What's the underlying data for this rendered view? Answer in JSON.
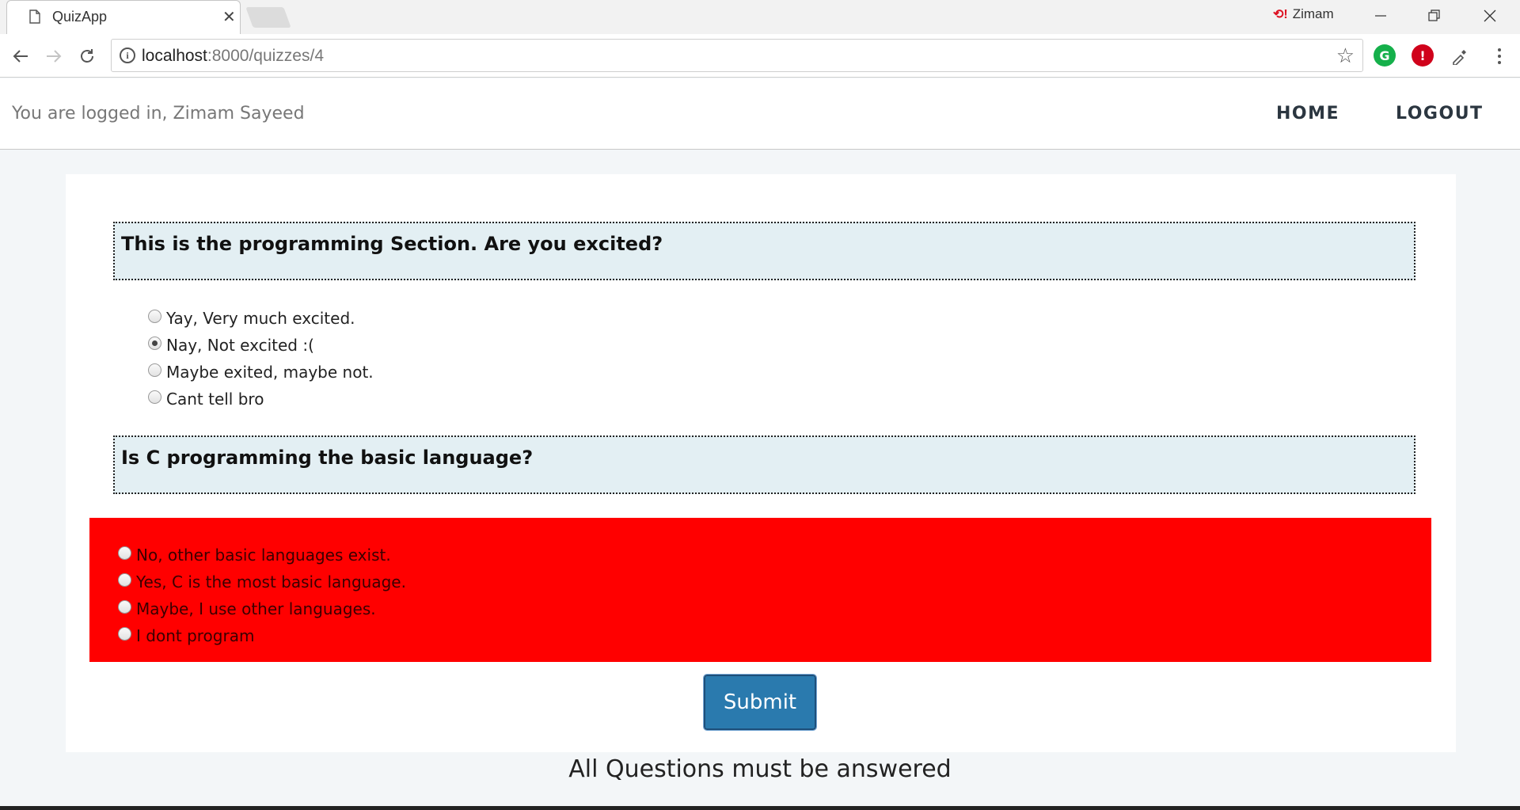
{
  "browser": {
    "tab_title": "QuizApp",
    "profile_name": "Zimam",
    "url_host": "localhost",
    "url_path": ":8000/quizzes/4"
  },
  "nav": {
    "login_text": "You are logged in, Zimam Sayeed",
    "home_label": "HOME",
    "logout_label": "LOGOUT"
  },
  "quiz": {
    "questions": [
      {
        "text": "This is the programming Section. Are you excited?",
        "options": [
          "Yay, Very much excited.",
          "Nay, Not excited :(",
          "Maybe exited, maybe not.",
          "Cant tell bro"
        ],
        "selected_index": 1
      },
      {
        "text": "Is C programming the basic language?",
        "options": [
          "No, other basic languages exist.",
          "Yes, C is the most basic language.",
          "Maybe, I use other languages.",
          "I dont program"
        ],
        "selected_index": null
      }
    ],
    "submit_label": "Submit",
    "error_color": "#ff0000"
  },
  "footer_message": "All Questions must be answered"
}
